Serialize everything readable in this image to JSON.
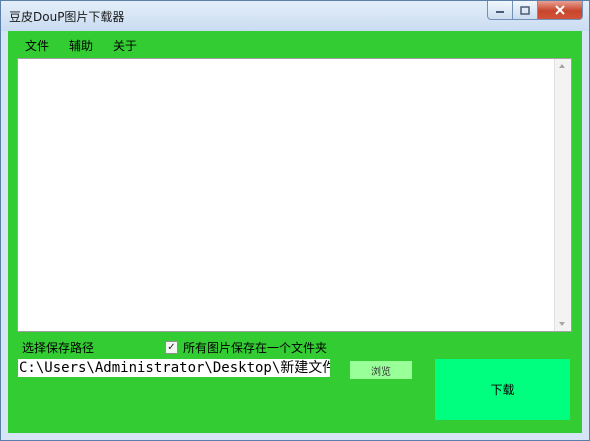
{
  "window": {
    "title": "豆皮DouP图片下载器",
    "controls": {
      "minimize_icon": "minimize-icon",
      "maximize_icon": "maximize-icon",
      "close_icon": "close-icon"
    }
  },
  "menu": {
    "items": [
      {
        "label": "文件"
      },
      {
        "label": "辅助"
      },
      {
        "label": "关于"
      }
    ]
  },
  "log_area": {
    "value": ""
  },
  "path": {
    "label": "选择保存路径",
    "value": "C:\\Users\\Administrator\\Desktop\\新建文件"
  },
  "save_single_folder": {
    "label": "所有图片保存在一个文件夹",
    "checked": true
  },
  "buttons": {
    "browse": "浏览",
    "download": "下载"
  },
  "colors": {
    "client_bg": "#33cc33",
    "browse_bg": "#99ff99",
    "download_bg": "#00ff7f"
  }
}
